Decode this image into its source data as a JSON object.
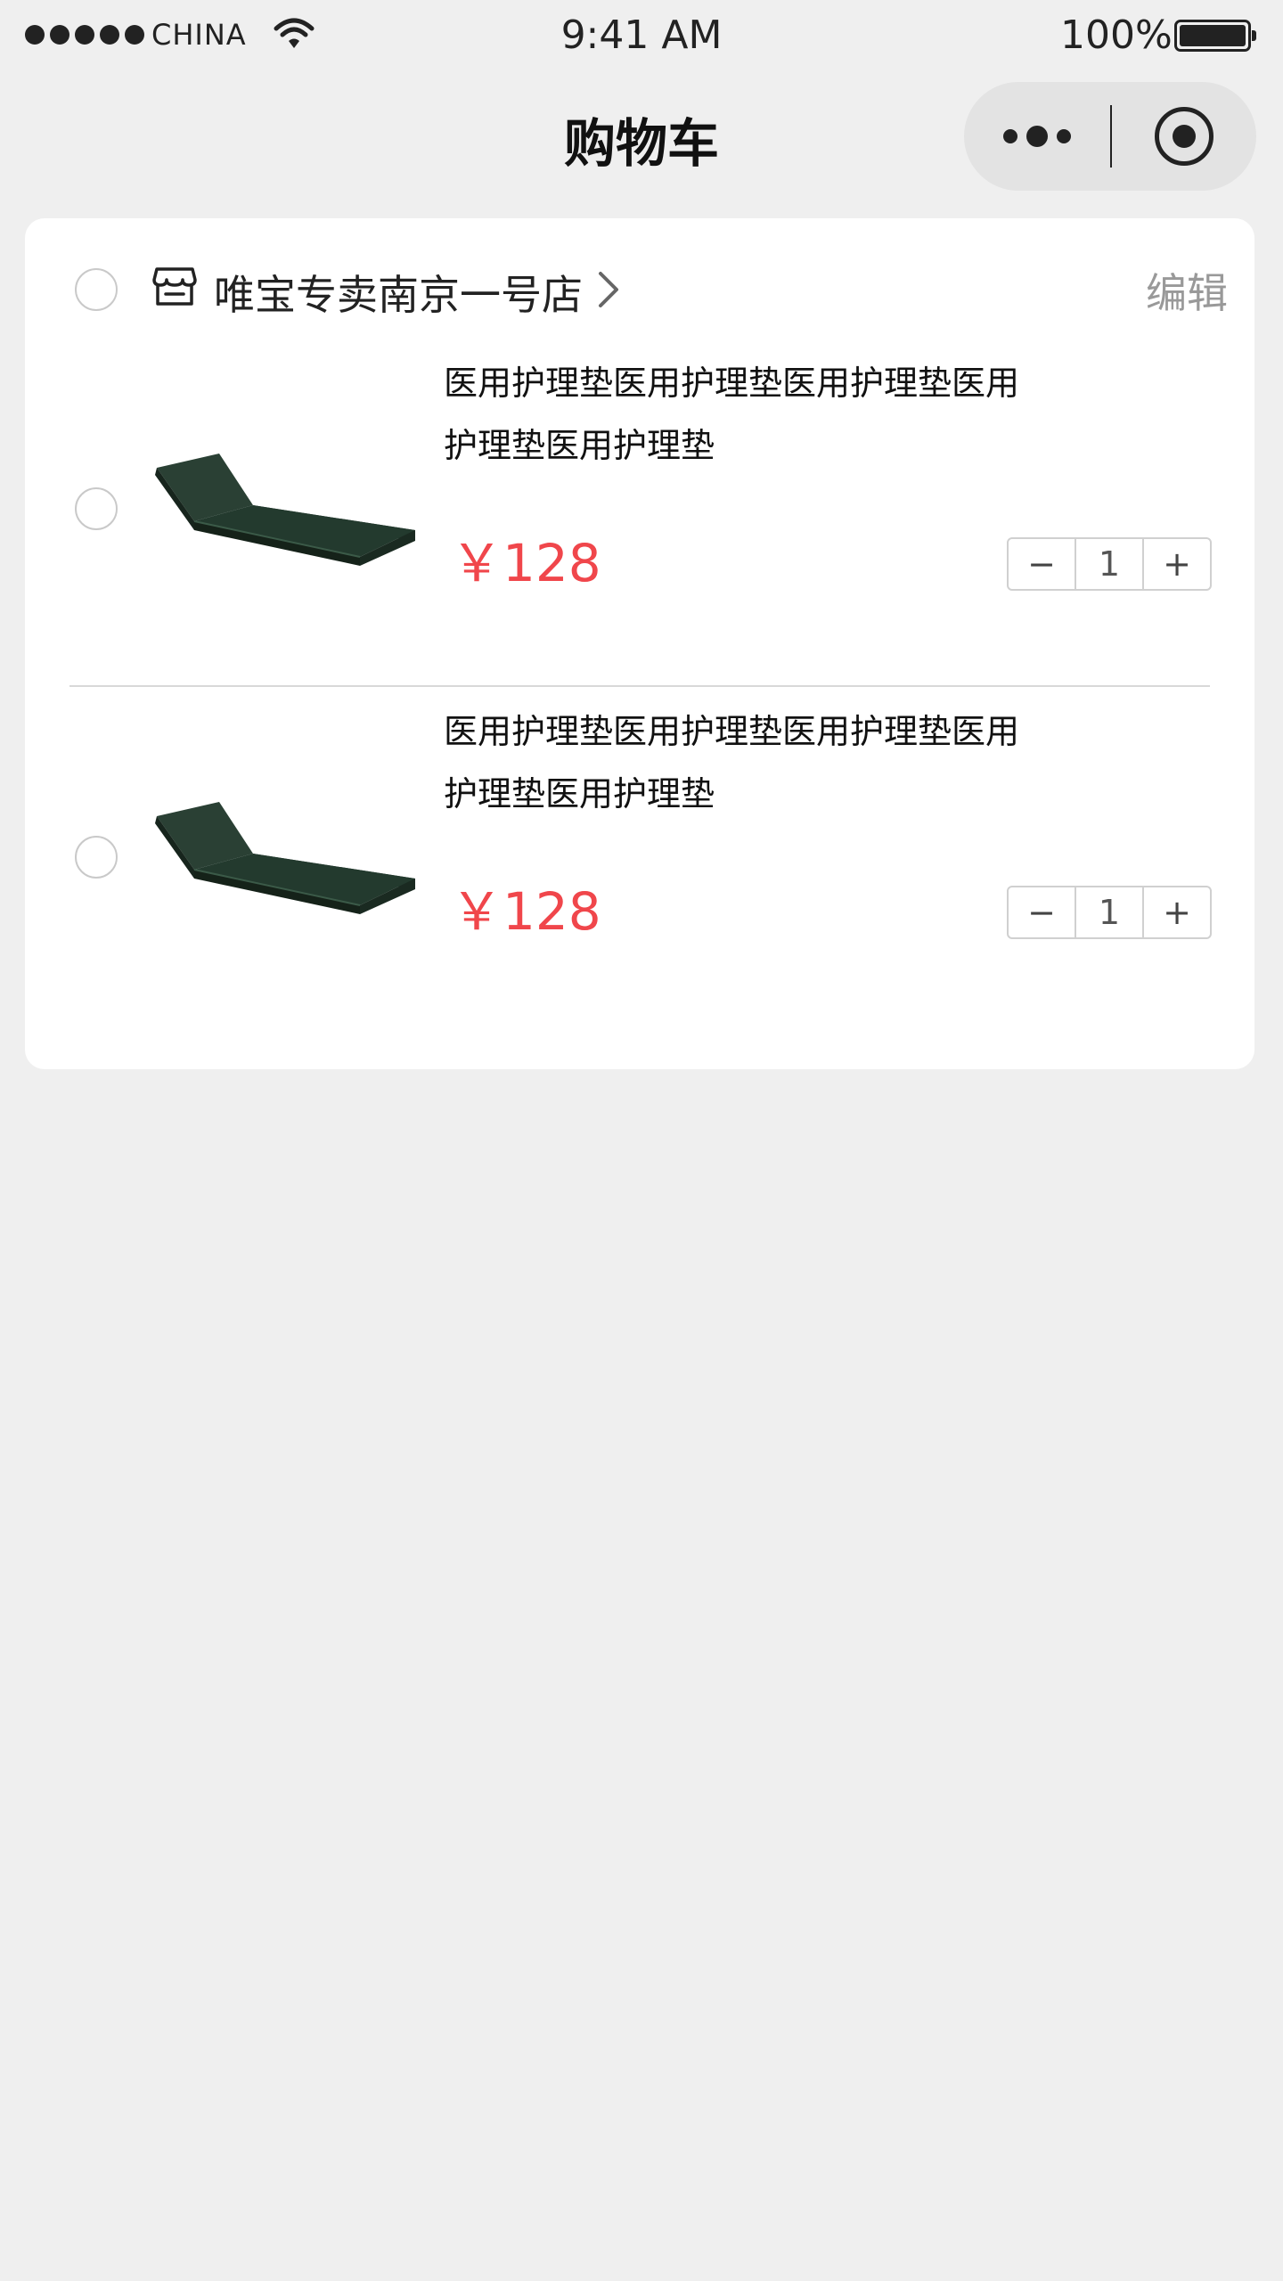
{
  "status_bar": {
    "carrier": "CHINA",
    "time": "9:41 AM",
    "battery": "100%"
  },
  "nav": {
    "title": "购物车"
  },
  "shop": {
    "name": "唯宝专卖南京一号店",
    "edit_label": "编辑"
  },
  "items": [
    {
      "title": "医用护理垫医用护理垫医用护理垫医用护理垫医用护理垫",
      "price": "￥128",
      "quantity": "1",
      "minus": "−",
      "plus": "+"
    },
    {
      "title": "医用护理垫医用护理垫医用护理垫医用护理垫医用护理垫",
      "price": "￥128",
      "quantity": "1",
      "minus": "−",
      "plus": "+"
    }
  ],
  "colors": {
    "price": "#f0464b",
    "background": "#efefef",
    "mattress": "#23382d"
  },
  "icons": [
    "signal-icon",
    "wifi-icon",
    "battery-icon",
    "more-icon",
    "target-icon",
    "shop-icon",
    "chevron-right-icon"
  ]
}
